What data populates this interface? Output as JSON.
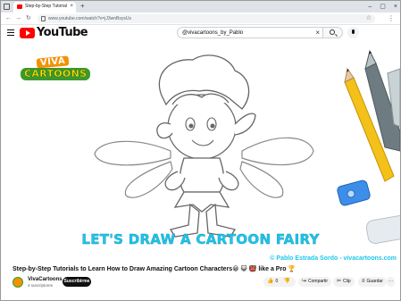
{
  "browser": {
    "tab_title": "Step-by-Step Tutorials to Learn H...",
    "tab_close": "×",
    "new_tab": "+",
    "url": "www.youtube.com/watch?v=jJ3wnBsysUs",
    "window_controls": [
      "–",
      "▢",
      "×"
    ],
    "back": "←",
    "forward": "→",
    "reload": "↻",
    "menu": "⋮"
  },
  "youtube": {
    "logo_text": "YouTube",
    "search_value": "@vivacartoons_by_Pablo",
    "search_clear": "×"
  },
  "video": {
    "logo_top": "VIVA",
    "logo_bottom": "CARTOONS",
    "overlay_title": "LET'S DRAW A CARTOON FAIRY",
    "credit": "© Pablo Estrada Sordo - vivacartoons.com"
  },
  "info": {
    "title": "Step-by-Step Tutorials to Learn How to Draw Amazing Cartoon Characters😀 😺 👹 like a Pro 🏆",
    "channel_name": "VivaCartoons",
    "subscribers": "4 suscriptores",
    "subscribe_label": "Suscribirme",
    "like_count": "0",
    "share_label": "Compartir",
    "clip_label": "Clip",
    "save_label": "Guardar",
    "more_label": "···"
  },
  "colors": {
    "brand_red": "#ff0000",
    "overlay_cyan": "#1ec6ea",
    "logo_orange": "#f39200",
    "logo_green": "#3a9a2e"
  }
}
